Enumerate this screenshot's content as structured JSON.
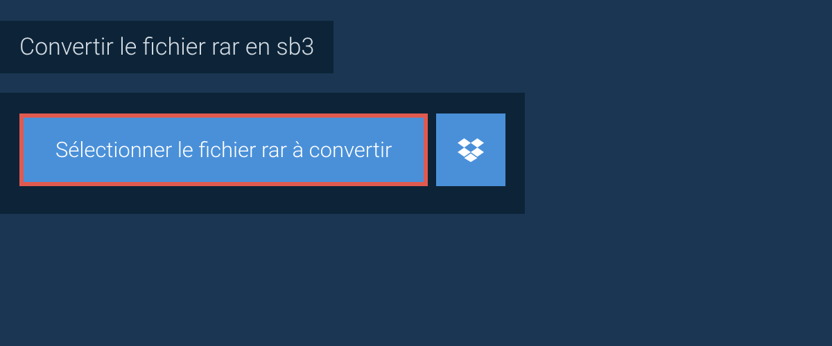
{
  "header": {
    "title": "Convertir le fichier rar en sb3"
  },
  "actions": {
    "select_file_label": "Sélectionner le fichier rar à convertir",
    "dropbox_icon": "dropbox"
  },
  "colors": {
    "background": "#1a3652",
    "panel": "#0d2438",
    "button": "#4a90d9",
    "highlight_border": "#e05a4f",
    "text_light": "#d5dde5"
  }
}
